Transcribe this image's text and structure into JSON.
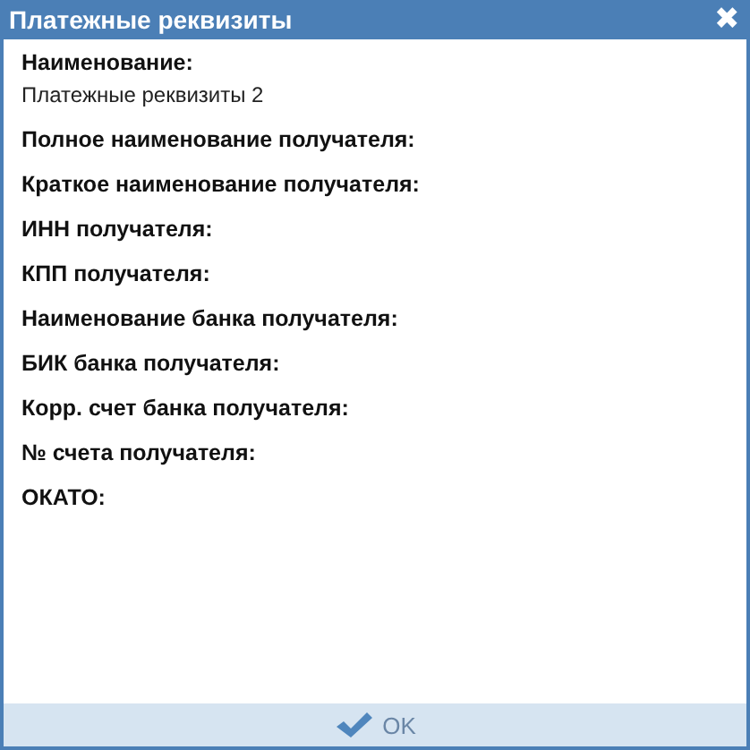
{
  "window": {
    "title": "Платежные реквизиты",
    "close": "✖"
  },
  "fields": [
    {
      "label": "Наименование:",
      "value": "Платежные реквизиты 2"
    },
    {
      "label": "Полное наименование получателя:"
    },
    {
      "label": "Краткое наименование получателя:"
    },
    {
      "label": "ИНН получателя:"
    },
    {
      "label": "КПП получателя:"
    },
    {
      "label": "Наименование банка получателя:"
    },
    {
      "label": "БИК банка получателя:"
    },
    {
      "label": "Корр. счет банка получателя:"
    },
    {
      "label": "№ счета получателя:"
    },
    {
      "label": "ОКАТО:"
    }
  ],
  "buttons": [
    {
      "label": "OK"
    }
  ]
}
